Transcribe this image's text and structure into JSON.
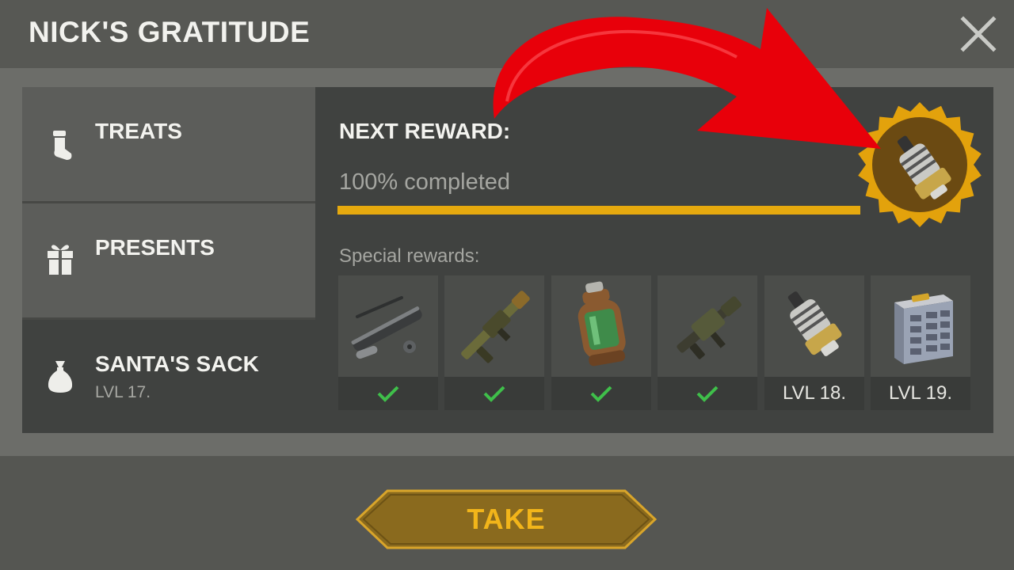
{
  "header": {
    "title": "NICK'S GRATITUDE"
  },
  "sidebar": {
    "items": [
      {
        "label": "TREATS",
        "icon": "stocking-icon"
      },
      {
        "label": "PRESENTS",
        "icon": "gift-icon"
      },
      {
        "label": "SANTA'S SACK",
        "sublabel": "LVL 17.",
        "icon": "sack-icon"
      }
    ]
  },
  "next_reward": {
    "label": "NEXT REWARD:",
    "progress_text": "100% completed",
    "progress": 1.0,
    "reward_icon": "gear-part-icon"
  },
  "special_rewards": {
    "label": "Special rewards:",
    "items": [
      {
        "icon": "rocket-launcher-parts-icon",
        "status": "checked"
      },
      {
        "icon": "rifle-icon",
        "status": "checked"
      },
      {
        "icon": "canister-icon",
        "status": "checked"
      },
      {
        "icon": "grenade-launcher-icon",
        "status": "checked"
      },
      {
        "icon": "gear-part-icon",
        "status": "LVL 18."
      },
      {
        "icon": "toolbox-icon",
        "status": "LVL 19."
      }
    ]
  },
  "actions": {
    "take_label": "TAKE"
  },
  "colors": {
    "accent": "#e6a90e",
    "check": "#3fbf4a",
    "arrow": "#e8000a"
  }
}
